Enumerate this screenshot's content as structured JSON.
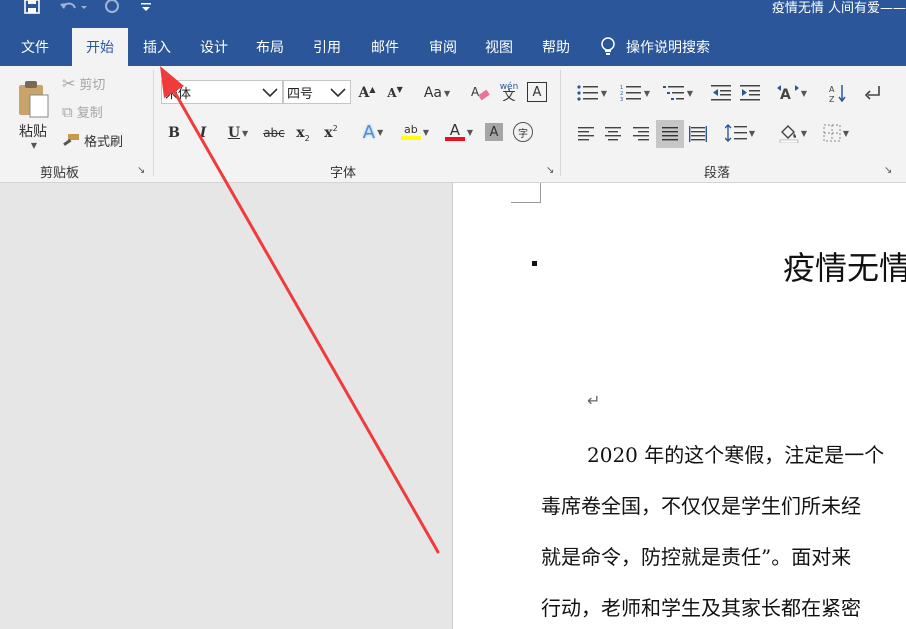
{
  "window": {
    "title": "疫情无情 人间有爱——"
  },
  "quick_access": {
    "save_icon": "save-icon",
    "undo_icon": "undo-icon",
    "redo_icon": "redo-icon",
    "customize_icon": "customize-qat-icon"
  },
  "tabs": [
    {
      "label": "文件",
      "active": false
    },
    {
      "label": "开始",
      "active": true
    },
    {
      "label": "插入",
      "active": false
    },
    {
      "label": "设计",
      "active": false
    },
    {
      "label": "布局",
      "active": false
    },
    {
      "label": "引用",
      "active": false
    },
    {
      "label": "邮件",
      "active": false
    },
    {
      "label": "审阅",
      "active": false
    },
    {
      "label": "视图",
      "active": false
    },
    {
      "label": "帮助",
      "active": false
    }
  ],
  "tell_me": {
    "label": "操作说明搜索",
    "icon": "lightbulb-icon"
  },
  "clipboard": {
    "paste": "粘贴",
    "cut": "剪切",
    "copy": "复制",
    "format_painter": "格式刷",
    "group_label": "剪贴板"
  },
  "font": {
    "name": "宋体",
    "size": "四号",
    "group_label": "字体",
    "grow": "A",
    "shrink": "A",
    "change_case": "Aa",
    "phonetic_top": "wén",
    "phonetic_bottom": "文",
    "border": "A",
    "bold": "B",
    "italic": "I",
    "underline": "U",
    "strike": "abc",
    "subscript": "x",
    "subscript_mark": "2",
    "superscript": "x",
    "superscript_mark": "2",
    "text_effect": "A",
    "highlight": "ab",
    "font_color": "A",
    "shading": "A",
    "enclose": "字",
    "highlight_color": "#ffff00",
    "font_color_value": "#e81123"
  },
  "paragraph": {
    "group_label": "段落"
  },
  "document": {
    "heading": "疫情无情",
    "lines": [
      "2020 年的这个寒假，注定是一个",
      "毒席卷全国，不仅仅是学生们所未经",
      "就是命令，防控就是责任”。面对来",
      "行动，老师和学生及其家长都在紧密"
    ]
  },
  "colors": {
    "title_bar": "#2b579a",
    "ribbon": "#f3f3f3",
    "canvas": "#e6e6e6",
    "annotation_arrow": "#ef3b3b"
  }
}
